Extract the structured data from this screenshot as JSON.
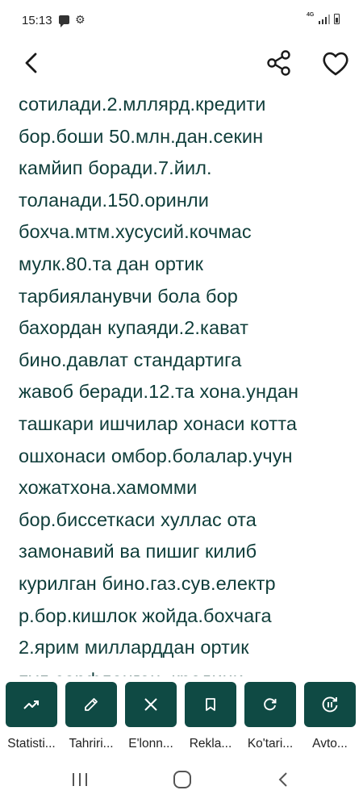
{
  "status_bar": {
    "time": "15:13",
    "network": "4G",
    "icons": [
      "message-icon",
      "gear-icon",
      "signal-icon",
      "battery-icon"
    ]
  },
  "app_bar": {
    "icons": [
      "back-arrow-icon",
      "share-icon",
      "heart-icon"
    ]
  },
  "description": {
    "lines": [
      "сотилади.2.мллярд.кредити",
      "бор.боши 50.млн.дан.секин",
      "камйип боради.7.йил.",
      "толанади.150.оринли",
      "бохча.мтм.хусусий.кочмас",
      "мулк.80.та дан ортик",
      "тарбияланувчи бола бор",
      "бахордан купаяди.2.кават",
      "бино.давлат стандартига",
      "жавоб беради.12.та хона.ундан",
      "ташкари ишчилар хонаси котта",
      "ошхонаси омбор.болалар.учун",
      "хожатхона.хамомми",
      "бор.биссеткаси хуллас ота",
      "замонавий ва пишиг килиб",
      "курилган бино.газ.сув.електр",
      "р.бор.кишлок жойда.бохчага",
      "2.ярим милларддан ортик",
      "пул сарфланган. кредини"
    ]
  },
  "actions": [
    {
      "label": "Statisti...",
      "icon": "trending-up-icon"
    },
    {
      "label": "Tahriri...",
      "icon": "pencil-icon"
    },
    {
      "label": "E'lonn...",
      "icon": "close-icon"
    },
    {
      "label": "Rekla...",
      "icon": "bookmark-icon"
    },
    {
      "label": "Ko'tari...",
      "icon": "refresh-icon"
    },
    {
      "label": "Avto...",
      "icon": "auto-renew-icon"
    }
  ],
  "colors": {
    "text": "#0f3d3a",
    "action_tile": "#0f4a44",
    "background": "#ffffff"
  },
  "nav_bar": {
    "icons": [
      "recents-icon",
      "home-icon",
      "nav-back-icon"
    ]
  }
}
